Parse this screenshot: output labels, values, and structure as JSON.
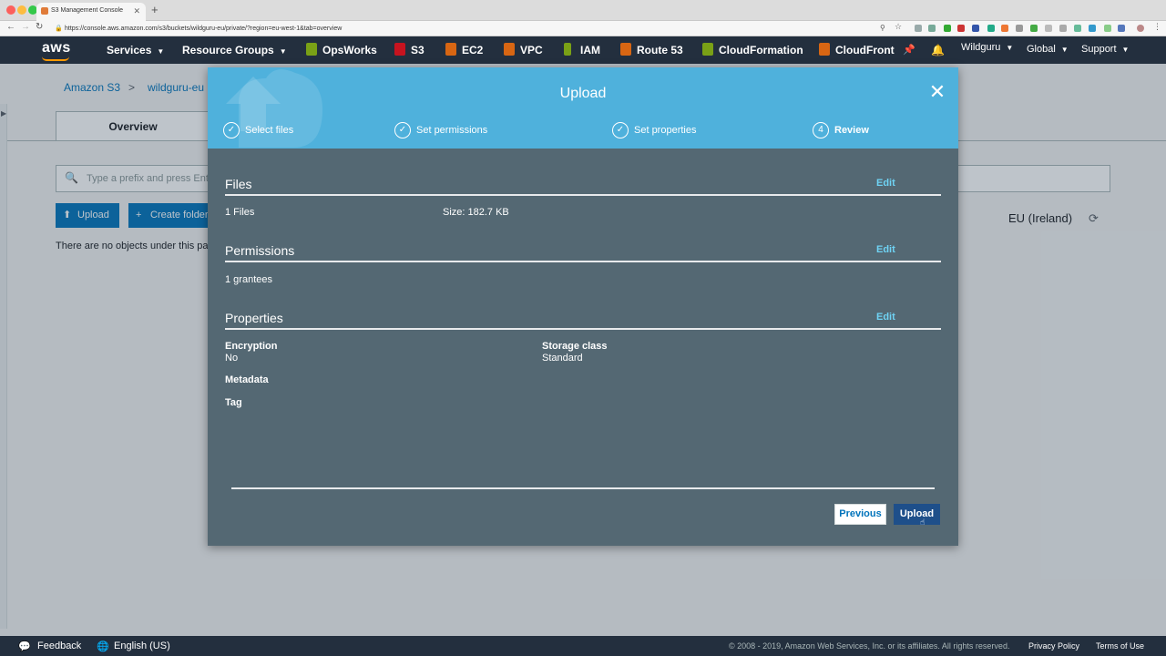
{
  "browser": {
    "tab_title": "S3 Management Console",
    "tab_close": "✕",
    "new_tab": "+",
    "url": "https://console.aws.amazon.com/s3/buckets/wildguru-eu/private/?region=eu-west-1&tab=overview"
  },
  "awsnav": {
    "logo": "aws",
    "services": "Services",
    "resource_groups": "Resource Groups",
    "shortcuts": [
      {
        "label": "OpsWorks",
        "color": "#7aa116"
      },
      {
        "label": "S3",
        "color": "#c7131f"
      },
      {
        "label": "EC2",
        "color": "#d86613"
      },
      {
        "label": "VPC",
        "color": "#d86613"
      },
      {
        "label": "IAM",
        "color": "#7aa116"
      },
      {
        "label": "Route 53",
        "color": "#d86613"
      },
      {
        "label": "CloudFormation",
        "color": "#7aa116"
      },
      {
        "label": "CloudFront",
        "color": "#d86613"
      }
    ],
    "user": "Wildguru",
    "region": "Global",
    "support": "Support"
  },
  "page": {
    "breadcrumb_root": "Amazon S3",
    "breadcrumb_sep": ">",
    "breadcrumb_bucket": "wildguru-eu",
    "tab_overview": "Overview",
    "search_placeholder": "Type a prefix and press Enter",
    "upload_button": "Upload",
    "create_folder_button": "Create folder",
    "region_label": "EU (Ireland)",
    "no_objects": "There are no objects under this path"
  },
  "modal": {
    "title": "Upload",
    "close": "✕",
    "steps": [
      {
        "label": "Select files",
        "icon": "✓"
      },
      {
        "label": "Set permissions",
        "icon": "✓"
      },
      {
        "label": "Set properties",
        "icon": "✓"
      },
      {
        "label": "Review",
        "icon": "4"
      }
    ],
    "files": {
      "title": "Files",
      "edit": "Edit",
      "count": "1 Files",
      "size": "Size: 182.7 KB"
    },
    "permissions": {
      "title": "Permissions",
      "edit": "Edit",
      "grantees": "1 grantees"
    },
    "properties": {
      "title": "Properties",
      "edit": "Edit",
      "encryption_label": "Encryption",
      "encryption_value": "No",
      "storage_label": "Storage class",
      "storage_value": "Standard",
      "metadata_label": "Metadata",
      "tag_label": "Tag"
    },
    "previous_button": "Previous",
    "upload_button": "Upload"
  },
  "footer": {
    "feedback": "Feedback",
    "language": "English (US)",
    "copyright": "© 2008 - 2019, Amazon Web Services, Inc. or its affiliates. All rights reserved.",
    "privacy": "Privacy Policy",
    "terms": "Terms of Use"
  }
}
